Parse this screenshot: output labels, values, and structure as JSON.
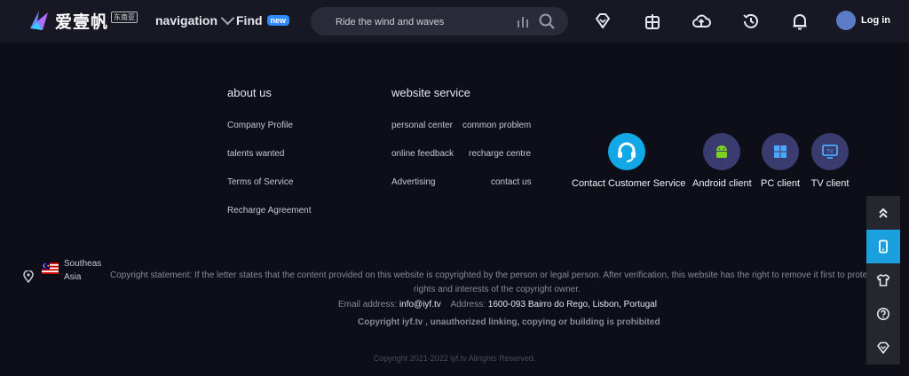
{
  "header": {
    "logo_text": "爱壹帆",
    "logo_badge": "东南亚",
    "nav_label": "navigation",
    "find_label": "Find",
    "new_badge": "new",
    "search_placeholder": "Ride the wind and waves",
    "login_label": "Log in",
    "icons": [
      "vip-diamond-icon",
      "apps-icon",
      "upload-cloud-icon",
      "history-icon",
      "bell-icon"
    ]
  },
  "footer": {
    "about": {
      "title": "about us",
      "links": [
        "Company Profile",
        "talents wanted",
        "Terms of Service",
        "Recharge Agreement"
      ]
    },
    "service": {
      "title": "website service",
      "links": [
        "personal center",
        "common problem",
        "online feedback",
        "recharge centre",
        "Advertising",
        "contact us"
      ]
    },
    "apps": [
      {
        "label": "Contact Customer Service",
        "icon": "headset-icon"
      },
      {
        "label": "Android client",
        "icon": "android-icon"
      },
      {
        "label": "PC client",
        "icon": "windows-icon"
      },
      {
        "label": "TV client",
        "icon": "tv-icon"
      }
    ]
  },
  "region": {
    "line1": "Southeas",
    "line2": "Asia"
  },
  "copyright": {
    "statement_line1": "Copyright statement: If the letter states that the content provided on this website is copyrighted by the person or legal person. After verification, this website has the right to remove it first to protect",
    "statement_line2": "rights and interests of the copyright owner.",
    "email_label": "Email address:",
    "email_value": "info@iyf.tv",
    "address_label": "Address:",
    "address_value": "1600-093 Bairro do Rego, Lisbon, Portugal",
    "notice": "Copyright iyf.tv , unauthorized linking, copying or building is prohibited",
    "bottom": "Copyright 2021-2022 iyf.tv Allrights Reserved."
  },
  "colors": {
    "background": "#0e0e18",
    "header": "#171824",
    "accent": "#1a9fdf",
    "badge": "#2f8bff"
  }
}
